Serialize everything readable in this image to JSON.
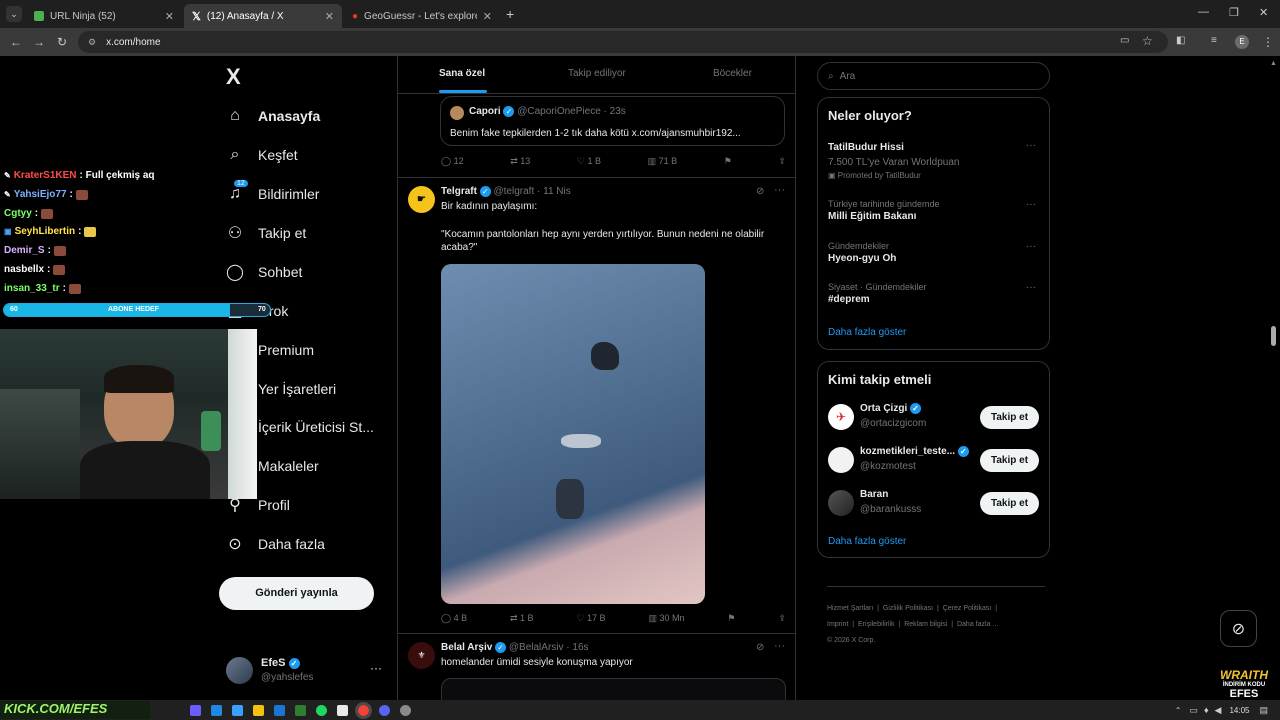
{
  "browser": {
    "tabs": [
      {
        "title": "URL Ninja (52)"
      },
      {
        "title": "(12) Anasayfa / X"
      },
      {
        "title": "GeoGuessr - Let's explore the w"
      }
    ],
    "address": "x.com/home",
    "profile_initial": "E"
  },
  "nav": {
    "logo": "X",
    "items": [
      {
        "label": "Anasayfa"
      },
      {
        "label": "Keşfet"
      },
      {
        "label": "Bildirimler",
        "badge": "12"
      },
      {
        "label": "Takip et"
      },
      {
        "label": "Sohbet"
      },
      {
        "label": "Grok"
      },
      {
        "label": "Premium"
      },
      {
        "label": "Yer İşaretleri"
      },
      {
        "label": "İçerik Üreticisi St..."
      },
      {
        "label": "Makaleler"
      },
      {
        "label": "Profil"
      },
      {
        "label": "Daha fazla"
      }
    ],
    "post_button": "Gönderi yayınla",
    "account": {
      "name": "EfeS",
      "handle": "@yahslefes"
    }
  },
  "feed": {
    "tabs": [
      "Sana özel",
      "Takip ediliyor",
      "Böcekler"
    ],
    "quote": {
      "name": "Capori",
      "handle": "@CaporiOnePiece",
      "time": "· 23s",
      "text": "Benim fake tepkilerden 1-2 tık daha kötü x.com/ajansmuhbir192..."
    },
    "post0_stats": {
      "replies": "12",
      "reposts": "13",
      "likes": "1 B",
      "views": "71 B"
    },
    "post1": {
      "name": "Telgraft",
      "handle": "@telgraft",
      "time": "· 11 Nis",
      "line1": "Bir kadının paylaşımı:",
      "line2": "\"Kocamın pantolonları hep aynı yerden yırtılıyor. Bunun nedeni ne olabilir",
      "line3": "acaba?\"",
      "stats": {
        "replies": "4 B",
        "reposts": "1 B",
        "likes": "17 B",
        "views": "30 Mn"
      }
    },
    "post2": {
      "name": "Belal Arşiv",
      "handle": "@BelalArsiv",
      "time": "· 16s",
      "text": "homelander ümidi sesiyle konuşma yapıyor"
    }
  },
  "sidebar": {
    "search_placeholder": "Ara",
    "trends_title": "Neler oluyor?",
    "trends": [
      {
        "meta": "",
        "title": "TatilBudur Hissi",
        "sub": "7.500 TL'ye Varan Worldpuan",
        "promo": "Promoted by TatilBudur"
      },
      {
        "meta": "Türkiye tarihinde gündemde",
        "title": "Milli Eğitim Bakanı"
      },
      {
        "meta": "Gündemdekiler",
        "title": "Hyeon-gyu Oh"
      },
      {
        "meta": "Siyaset · Gündemdekiler",
        "title": "#deprem"
      }
    ],
    "show_more": "Daha fazla göster",
    "who_title": "Kimi takip etmeli",
    "who": [
      {
        "name": "Orta Çizgi",
        "handle": "@ortacizgicom",
        "button": "Takip et"
      },
      {
        "name": "kozmetikleri_teste...",
        "handle": "@kozmotest",
        "button": "Takip et"
      },
      {
        "name": "Baran",
        "handle": "@barankusss",
        "button": "Takip et"
      }
    ],
    "who_more": "Daha fazla göster",
    "footer": [
      "Hizmet Şartları",
      "Gizlilik Politikası",
      "Çerez Politikası",
      "Imprint",
      "Erişilebilirlik",
      "Reklam bilgisi",
      "Daha fazla ...",
      "© 2026 X Corp."
    ]
  },
  "stream": {
    "chat": [
      {
        "user": "KraterS1KEN",
        "msg": ": Full çekmiş aq",
        "color": "#ff4d4d"
      },
      {
        "user": "YahsiEjo77",
        "msg": ":",
        "color": "#7fb2ff"
      },
      {
        "user": "Cgtyy",
        "msg": ":",
        "color": "#7dff6a"
      },
      {
        "user": "SeyhLibertin",
        "msg": ":",
        "color": "#ffe44d"
      },
      {
        "user": "Demir_S",
        "msg": ":",
        "color": "#d8b3ff"
      },
      {
        "user": "nasbellx",
        "msg": ":",
        "color": "#ffffff"
      },
      {
        "user": "insan_33_tr",
        "msg": ":",
        "color": "#7dff6a"
      }
    ],
    "goal": {
      "left": "60",
      "label": "ABONE HEDEF",
      "right": "70",
      "progress": 0.85
    },
    "footer_text": "KICK.COM/EFES",
    "brand": "WRAITH",
    "brand_sub": "İNDİRİM KODU",
    "brand_code": "EFES"
  },
  "taskbar": {
    "time": "14:05"
  }
}
